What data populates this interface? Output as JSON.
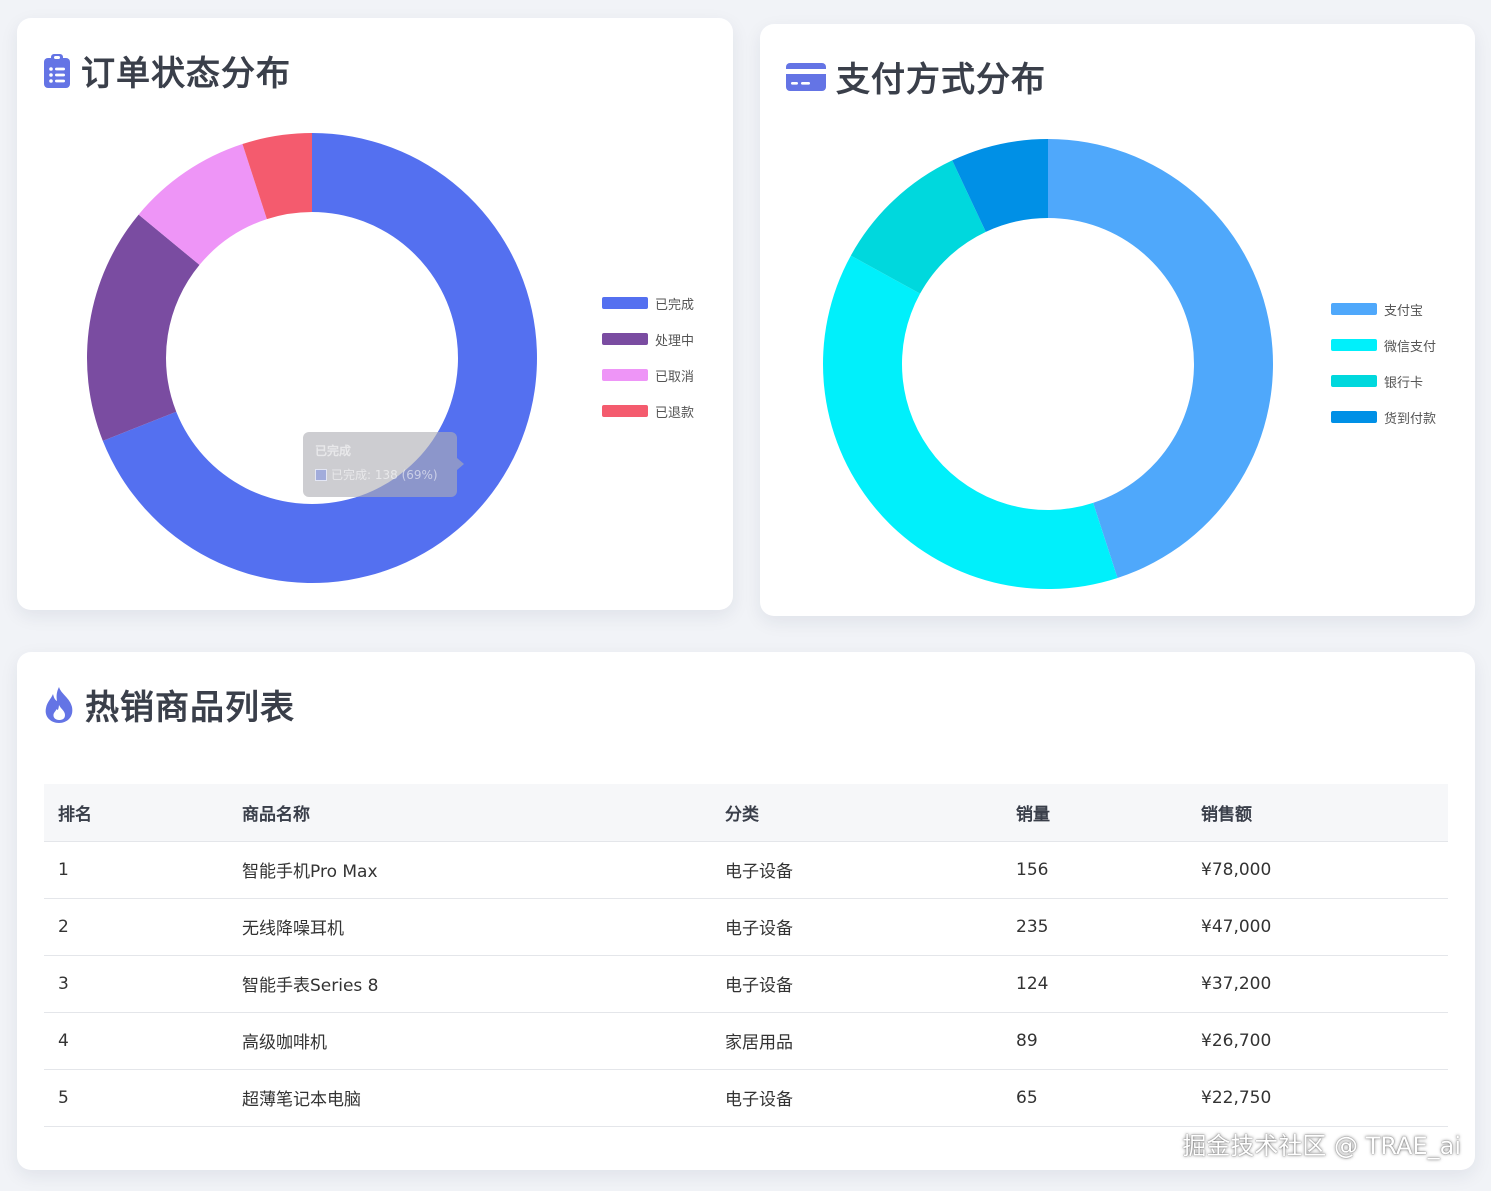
{
  "orders_card": {
    "title": "订单状态分布",
    "icon": "clipboard-list-icon",
    "chart_data": {
      "type": "pie",
      "series": [
        {
          "name": "已完成",
          "value": 69,
          "color": "#5470f0"
        },
        {
          "name": "处理中",
          "value": 17,
          "color": "#7a4ca1"
        },
        {
          "name": "已取消",
          "value": 9,
          "color": "#ee95f7"
        },
        {
          "name": "已退款",
          "value": 5,
          "color": "#f45b6e"
        }
      ]
    },
    "tooltip": {
      "title": "已完成",
      "text": "已完成: 138 (69%)"
    }
  },
  "payment_card": {
    "title": "支付方式分布",
    "icon": "credit-card-icon",
    "chart_data": {
      "type": "pie",
      "series": [
        {
          "name": "支付宝",
          "value": 45,
          "color": "#4fa8fb"
        },
        {
          "name": "微信支付",
          "value": 38,
          "color": "#00f0fb"
        },
        {
          "name": "银行卡",
          "value": 10,
          "color": "#00d8dd"
        },
        {
          "name": "货到付款",
          "value": 7,
          "color": "#0090e6"
        }
      ]
    }
  },
  "products_card": {
    "title": "热销商品列表",
    "icon": "fire-icon",
    "columns": [
      "排名",
      "商品名称",
      "分类",
      "销量",
      "销售额"
    ],
    "rows": [
      [
        "1",
        "智能手机Pro Max",
        "电子设备",
        "156",
        "¥78,000"
      ],
      [
        "2",
        "无线降噪耳机",
        "电子设备",
        "235",
        "¥47,000"
      ],
      [
        "3",
        "智能手表Series 8",
        "电子设备",
        "124",
        "¥37,200"
      ],
      [
        "4",
        "高级咖啡机",
        "家居用品",
        "89",
        "¥26,700"
      ],
      [
        "5",
        "超薄笔记本电脑",
        "电子设备",
        "65",
        "¥22,750"
      ]
    ]
  },
  "watermark": "掘金技术社区 @ TRAE_ai",
  "colors": {
    "accent": "#6474e5",
    "title_text": "#3a3f4a",
    "background": "#f1f3f7"
  }
}
